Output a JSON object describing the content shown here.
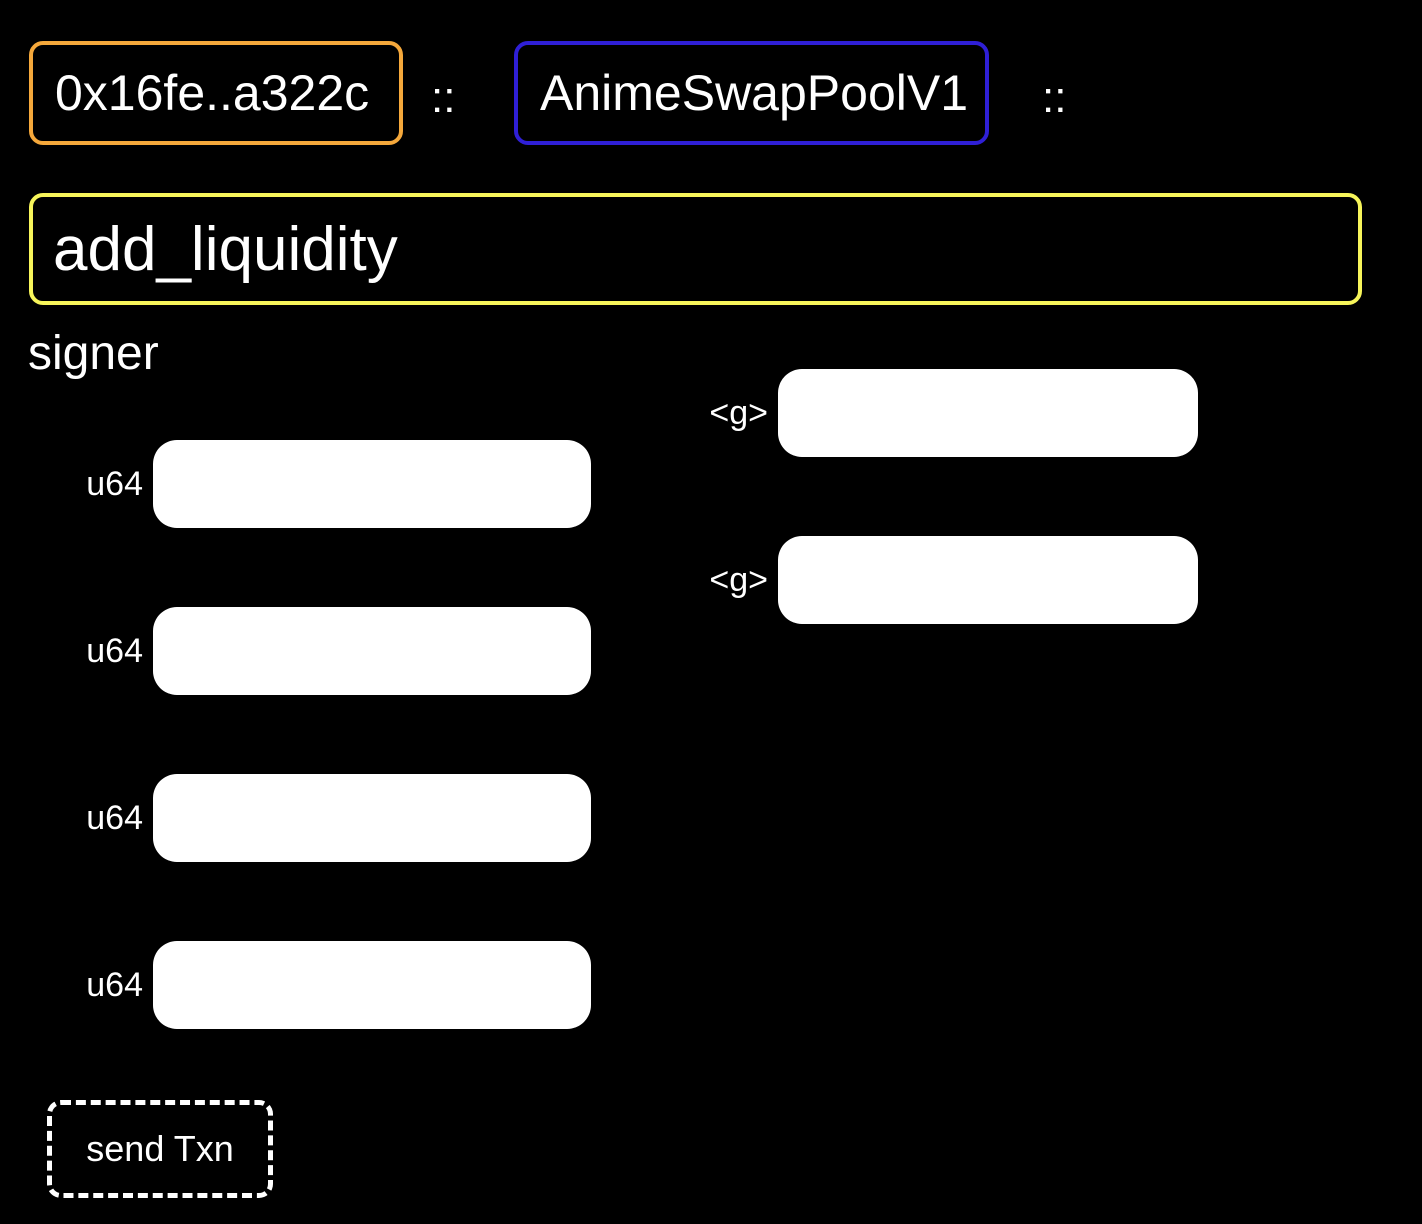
{
  "header": {
    "address": "0x16fe..a322c",
    "separator_1": "::",
    "module": "AnimeSwapPoolV1",
    "separator_2": "::"
  },
  "function": {
    "name": "add_liquidity"
  },
  "params": {
    "signer_label": "signer",
    "u64_fields": [
      {
        "label": "u64",
        "value": ""
      },
      {
        "label": "u64",
        "value": ""
      },
      {
        "label": "u64",
        "value": ""
      },
      {
        "label": "u64",
        "value": ""
      }
    ],
    "generic_fields": [
      {
        "label": "<g>",
        "value": ""
      },
      {
        "label": "<g>",
        "value": ""
      }
    ]
  },
  "actions": {
    "send_label": "send Txn"
  },
  "colors": {
    "background": "#000000",
    "address_border": "#f5a83b",
    "module_border": "#2f1fd6",
    "function_border": "#f7f55a",
    "input_fill": "#ffffff"
  }
}
